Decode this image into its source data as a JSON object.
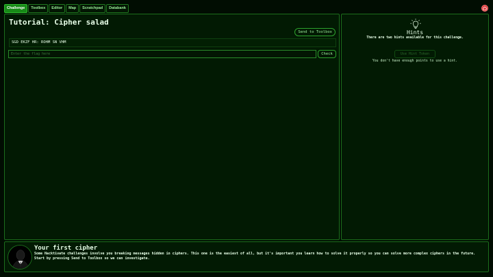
{
  "nav": {
    "tabs": [
      {
        "label": "Challenge",
        "active": true
      },
      {
        "label": "Toolbox",
        "active": false
      },
      {
        "label": "Editor",
        "active": false
      },
      {
        "label": "Map",
        "active": false
      },
      {
        "label": "Scratchpad",
        "active": false
      },
      {
        "label": "Databank",
        "active": false
      }
    ],
    "power_icon": "power-icon",
    "panel_icon": "sidebar-toggle-icon"
  },
  "challenge": {
    "title": "Tutorial: Cipher salad",
    "send_label": "Send to Toolbox",
    "cipher_text": "SGD EKZF HR: ROHM SN VHM",
    "flag_placeholder": "Enter the flag here",
    "flag_value": "",
    "check_label": "Check"
  },
  "hints": {
    "icon": "lightbulb-icon",
    "title": "Hints",
    "subtitle": "There are two hints available for this challenge.",
    "use_label": "Use Hint Token",
    "note": "You don't have enough points to use a hint."
  },
  "tutorial": {
    "avatar_icon": "hacker-avatar",
    "title": "Your first cipher",
    "text": "Some Hacktivate challenges involve you breaking messages hidden in ciphers. This one is the easiest of all, but it's important you learn how to solve it properly so you can solve more complex ciphers in the future. Start by pressing Send to Toolbox so we can investigate."
  },
  "colors": {
    "background": "#010d02",
    "accent": "#178a17",
    "border": "#1c6e1c",
    "power": "#d93030"
  }
}
